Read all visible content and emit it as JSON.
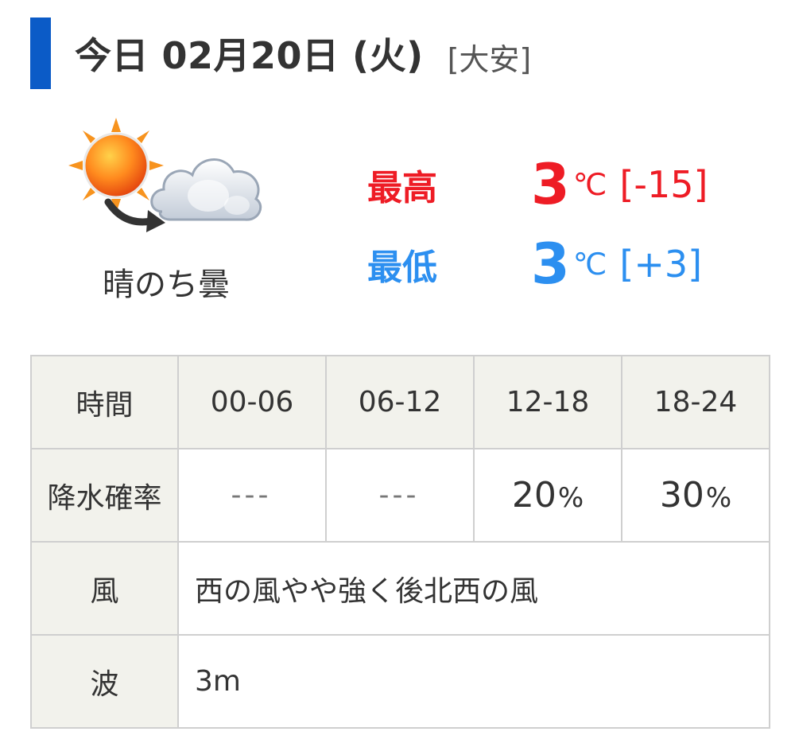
{
  "header": {
    "title": "今日 02月20日 (火)",
    "rokuyo": "[大安]",
    "accent_color": "#0b5bc7"
  },
  "weather": {
    "icon": "sunny-then-cloudy-icon",
    "label": "晴のち曇"
  },
  "temperature": {
    "high": {
      "label": "最高",
      "value": "3",
      "unit": "℃",
      "diff": "[-15]",
      "color": "#ee1c25"
    },
    "low": {
      "label": "最低",
      "value": "3",
      "unit": "℃",
      "diff": "[+3]",
      "color": "#2c8ff0"
    }
  },
  "table": {
    "time_header": "時間",
    "periods": [
      "00-06",
      "06-12",
      "12-18",
      "18-24"
    ],
    "precip_header": "降水確率",
    "precip": [
      {
        "value": "---",
        "unit": ""
      },
      {
        "value": "---",
        "unit": ""
      },
      {
        "value": "20",
        "unit": "%"
      },
      {
        "value": "30",
        "unit": "%"
      }
    ],
    "wind_header": "風",
    "wind": "西の風やや強く後北西の風",
    "wave_header": "波",
    "wave": "3m"
  }
}
